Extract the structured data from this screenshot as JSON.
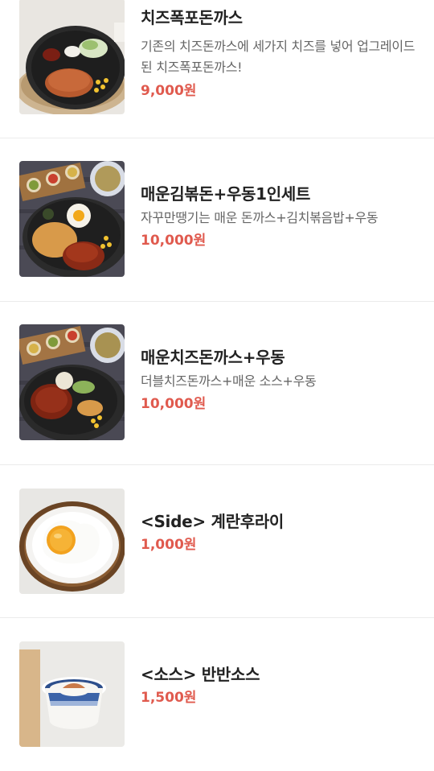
{
  "menu": {
    "items": [
      {
        "name": "치즈폭포돈까스",
        "description": "기존의 치즈돈까스에 세가지 치즈를 넣어 업그레이드 된 치즈폭포돈까스!",
        "price": "9,000원",
        "image_icon": "cheese-cutlet-plate-image"
      },
      {
        "name": "매운김볶돈+우동1인세트",
        "description": "자꾸만땡기는 매운 돈까스+김치볶음밥+우동",
        "price": "10,000원",
        "image_icon": "spicy-kimchi-rice-set-image"
      },
      {
        "name": "매운치즈돈까스+우동",
        "description": "더블치즈돈까스+매운 소스+우동",
        "price": "10,000원",
        "image_icon": "spicy-cheese-cutlet-set-image"
      },
      {
        "name": "<Side> 계란후라이",
        "description": "",
        "price": "1,000원",
        "image_icon": "fried-egg-image"
      },
      {
        "name": "<소스> 반반소스",
        "description": "",
        "price": "1,500원",
        "image_icon": "sauce-bowl-image"
      }
    ]
  }
}
